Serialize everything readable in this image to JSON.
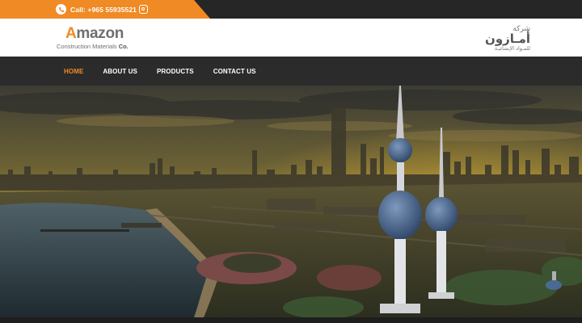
{
  "topbar": {
    "call_text": "Call: +965 55935521",
    "icons": [
      "phone-icon",
      "instagram-icon"
    ],
    "accent": "#f08a24"
  },
  "logo": {
    "main_first": "A",
    "main_rest": "mazon",
    "sub_text": "Construction Materials",
    "sub_suffix": "Co."
  },
  "logo_arabic": {
    "line1": "شركة",
    "line2": "أمـازون",
    "line3": "للمـواد الإنشائيـة"
  },
  "nav": {
    "items": [
      {
        "label": "HOME",
        "active": true
      },
      {
        "label": "ABOUT US",
        "active": false
      },
      {
        "label": "PRODUCTS",
        "active": false
      },
      {
        "label": "CONTACT US",
        "active": false
      }
    ]
  },
  "hero": {
    "image": "kuwait-towers-skyline-photo"
  }
}
